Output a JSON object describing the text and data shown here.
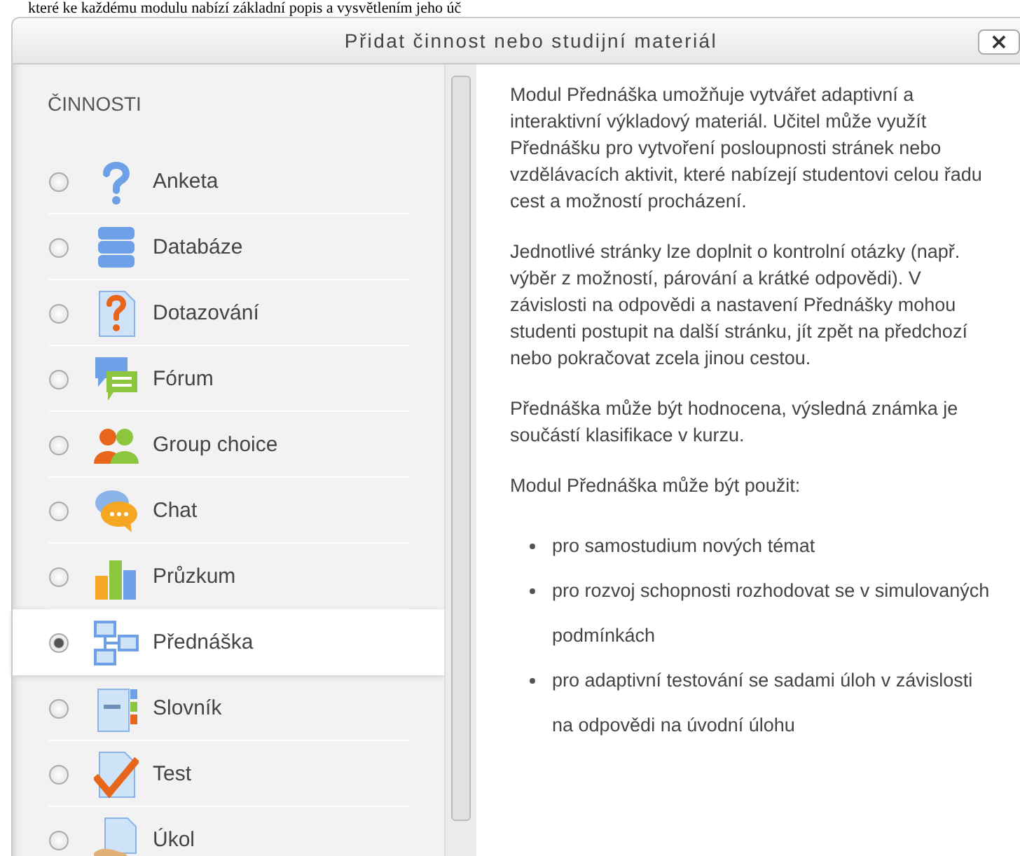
{
  "page_text_above": "které ke každému modulu nabízí základní popis  a vysvětlením jeho úč",
  "dialog": {
    "title": "Přidat činnost nebo studijní materiál",
    "close": "×"
  },
  "section_heading": "ČINNOSTI",
  "activities": [
    {
      "label": "Anketa",
      "selected": false
    },
    {
      "label": "Databáze",
      "selected": false
    },
    {
      "label": "Dotazování",
      "selected": false
    },
    {
      "label": "Fórum",
      "selected": false
    },
    {
      "label": "Group choice",
      "selected": false
    },
    {
      "label": "Chat",
      "selected": false
    },
    {
      "label": "Průzkum",
      "selected": false
    },
    {
      "label": "Přednáška",
      "selected": true
    },
    {
      "label": "Slovník",
      "selected": false
    },
    {
      "label": "Test",
      "selected": false
    },
    {
      "label": "Úkol",
      "selected": false
    }
  ],
  "description": {
    "paragraphs": [
      "Modul Přednáška umožňuje vytvářet adaptivní a interaktivní výkladový materiál. Učitel může využít Přednášku pro vytvoření posloupnosti stránek nebo vzdělávacích aktivit, které nabízejí studentovi celou řadu cest a možností procházení.",
      "Jednotlivé stránky lze doplnit o kontrolní otázky (např. výběr z možností, párování a krátké odpovědi). V závislosti na odpovědi a nastavení Přednášky mohou studenti postupit na další stránku, jít zpět na předchozí nebo pokračovat zcela jinou cestou.",
      "Přednáška může být hodnocena, výsledná známka je součástí klasifikace v kurzu.",
      "Modul Přednáška může být použit:"
    ],
    "bullets": [
      "pro samostudium nových témat",
      "pro rozvoj schopnosti rozhodovat se v simulovaných podmínkách",
      "pro adaptivní testování se sadami úloh v závislosti na odpovědi na úvodní úlohu"
    ]
  }
}
